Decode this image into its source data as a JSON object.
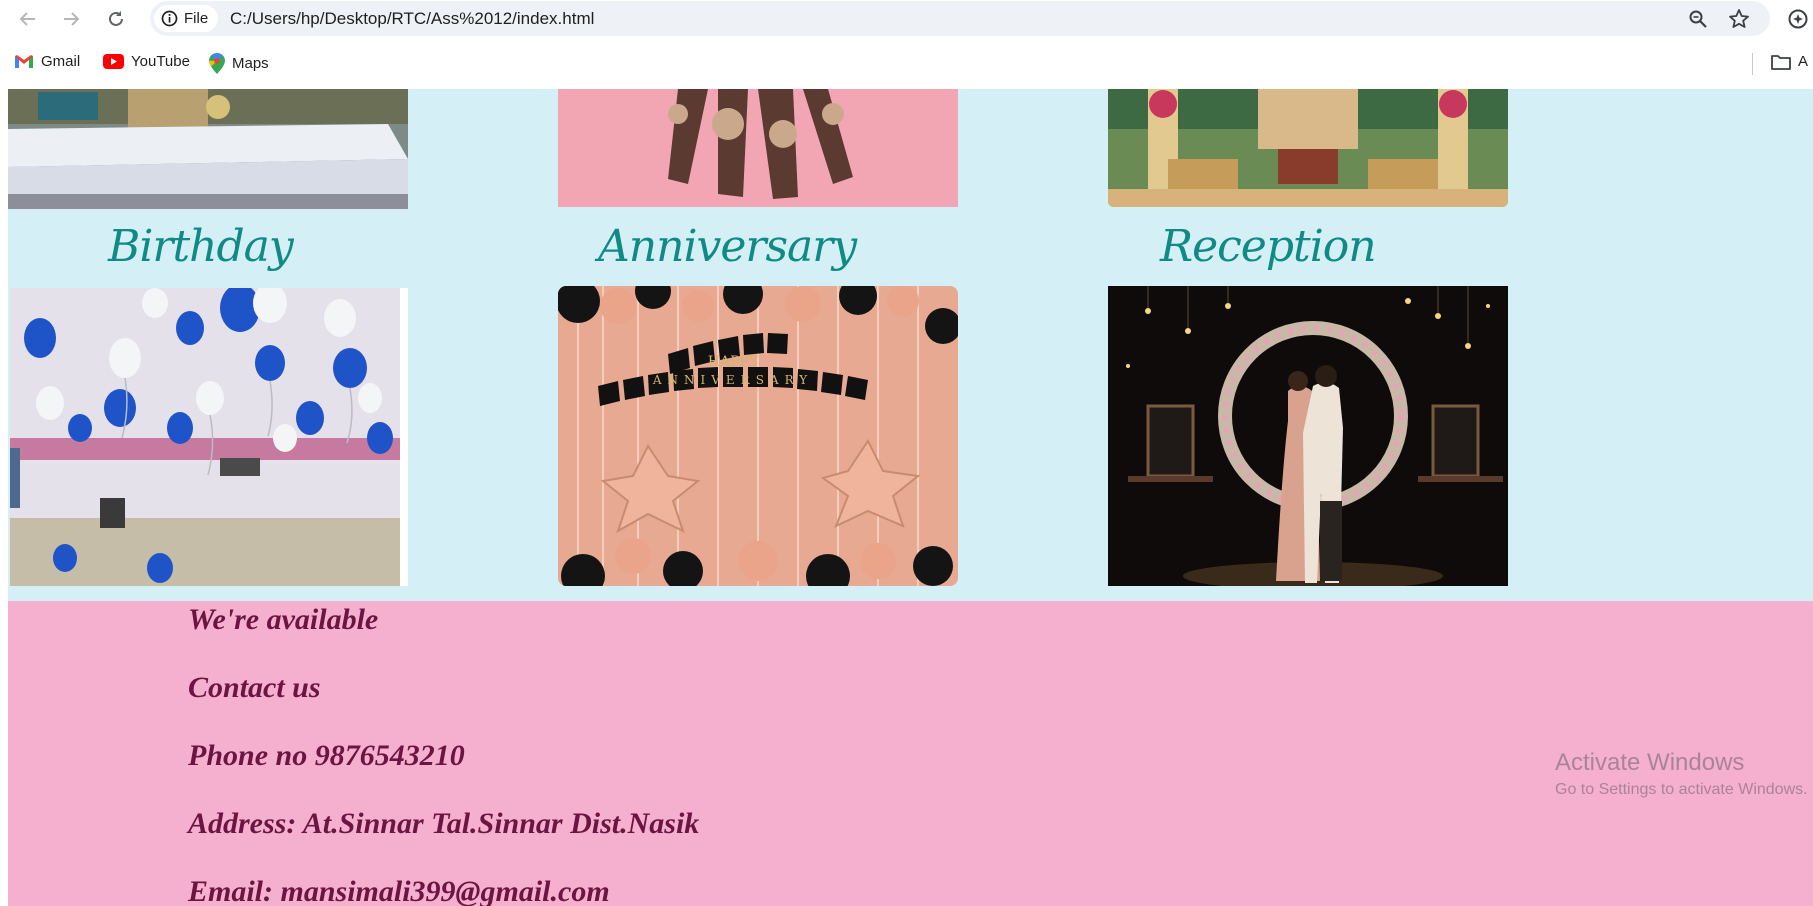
{
  "browser": {
    "site_info_label": "File",
    "url": "C:/Users/hp/Desktop/RTC/Ass%2012/index.html",
    "bookmarks": [
      {
        "label": "Gmail",
        "icon": "gmail-icon"
      },
      {
        "label": "YouTube",
        "icon": "youtube-icon"
      },
      {
        "label": "Maps",
        "icon": "maps-icon"
      }
    ],
    "bookmarks_overflow_label": "A"
  },
  "gallery": {
    "captions": [
      "Birthday",
      "Anniversary",
      "Reception"
    ],
    "image_texts": {
      "anniversary_banner_line1": "HAPPY",
      "anniversary_banner_line2": "ANNIVERSARY"
    }
  },
  "contact": {
    "lines": [
      "We're available",
      "Contact us",
      "Phone no 9876543210",
      "Address: At.Sinnar Tal.Sinnar Dist.Nasik",
      "Email: mansimali399@gmail.com"
    ]
  },
  "overlay": {
    "watermark_title": "Activate Windows",
    "watermark_subtitle": "Go to Settings to activate Windows."
  },
  "colors": {
    "gallery_bg": "#d5eff6",
    "caption": "#0f8a84",
    "contact_bg": "#f5afcf",
    "contact_text": "#6d1542"
  }
}
